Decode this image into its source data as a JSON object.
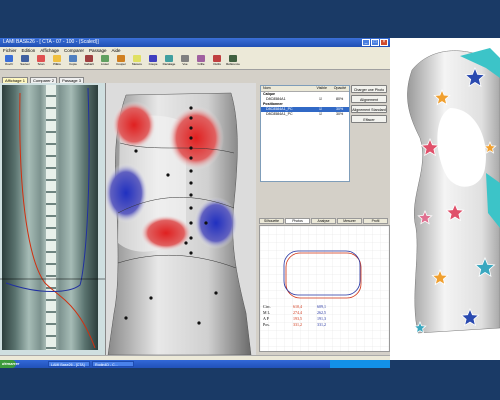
{
  "window": {
    "title": "LAMI BASE26 - [ CTA - 07 - 100 - (Scaled)]"
  },
  "menu": [
    "Fichier",
    "Edition",
    "Affichage",
    "Comparer",
    "Passage",
    "Aide"
  ],
  "toolbar": [
    {
      "label": "Ouvrir",
      "color": "#3a6fd8"
    },
    {
      "label": "Sauver",
      "color": "#4060a0"
    },
    {
      "label": "Scan",
      "color": "#e05050"
    },
    {
      "label": "Plâtre",
      "color": "#f0c040"
    },
    {
      "label": "Copie",
      "color": "#5080c0"
    },
    {
      "label": "Gabarit",
      "color": "#a04040"
    },
    {
      "label": "Lisser",
      "color": "#60a060"
    },
    {
      "label": "Couper",
      "color": "#d08020"
    },
    {
      "label": "Mesure",
      "color": "#e0e060"
    },
    {
      "label": "Coupe",
      "color": "#4040c0"
    },
    {
      "label": "Décalage",
      "color": "#40a0a0"
    },
    {
      "label": "Vue",
      "color": "#808080"
    },
    {
      "label": "Grille",
      "color": "#a060a0"
    },
    {
      "label": "Outils",
      "color": "#c04040"
    },
    {
      "label": "Référence",
      "color": "#406040"
    }
  ],
  "tabs": [
    "Affichage 1",
    "Comparer 2",
    "Passage 3"
  ],
  "list": {
    "columns": [
      "Nom",
      "Visible",
      "Opacité"
    ],
    "groups": [
      {
        "title": "Calque",
        "rows": [
          {
            "name": "D8C8584A1",
            "op": "80%",
            "selected": false
          }
        ]
      },
      {
        "title": "Positionner",
        "rows": [
          {
            "name": "D8C8584A1_PC",
            "op": "30%",
            "selected": true
          },
          {
            "name": "D8C8584A1_PC",
            "op": "30%",
            "selected": false
          }
        ]
      }
    ]
  },
  "buttons": [
    "Charger une Photo",
    "Alignement",
    "Alignement Standard",
    "Effacer"
  ],
  "panel_tabs": [
    "Silhouette",
    "Photos",
    "Analyse",
    "Mesurer",
    "Profil"
  ],
  "stats": [
    {
      "k": "Circ.",
      "a": "610,4",
      "b": "609,1"
    },
    {
      "k": "M L",
      "a": "274,4",
      "b": "262,5"
    },
    {
      "k": "A P",
      "a": "193,5",
      "b": "191,3"
    },
    {
      "k": "Pos.",
      "a": "331,2",
      "b": "331,2"
    }
  ],
  "taskbar": {
    "start": "démarrer",
    "items": [
      "LAMI Base26 - [CTA]",
      "Rodin4D - C..."
    ]
  },
  "colors": {
    "accent": "#1f4fb4",
    "red_zone": "#e02020",
    "blue_zone": "#2030c0",
    "background": "#1a3a66"
  }
}
